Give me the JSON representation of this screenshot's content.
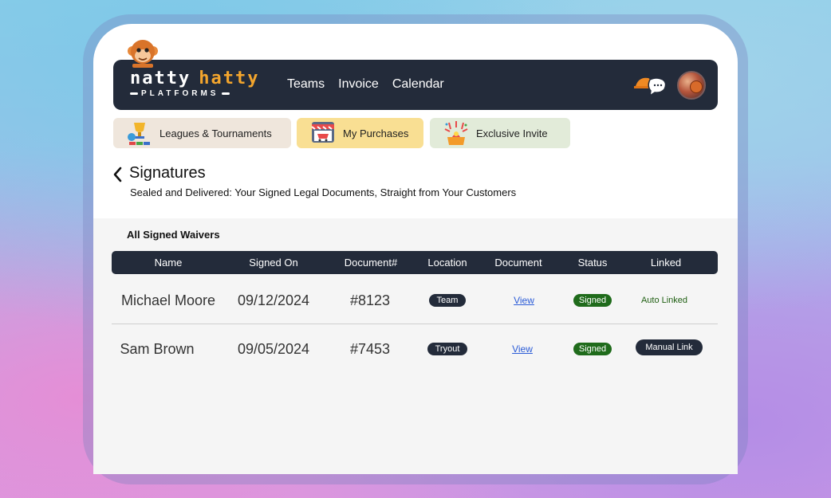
{
  "brand": {
    "word1": "natty",
    "word2": "hatty",
    "sub": "PLATFORMS",
    "accent": "#f3a52d",
    "nav_bg": "#232b3a"
  },
  "nav": {
    "links": [
      "Teams",
      "Invoice",
      "Calendar"
    ]
  },
  "icons": {
    "mascot": "monkey-icon",
    "chat": "cap-chat-icon",
    "avatar": "basketball-avatar",
    "back": "chevron-left-icon"
  },
  "chips": [
    {
      "label": "Leagues & Tournaments",
      "icon": "trophy-icon",
      "color": "#efe6dc"
    },
    {
      "label": "My Purchases",
      "icon": "shop-icon",
      "color": "#f9df93"
    },
    {
      "label": "Exclusive Invite",
      "icon": "party-icon",
      "color": "#e2ebd9"
    }
  ],
  "page": {
    "title": "Signatures",
    "subtitle": "Sealed and Delivered: Your Signed Legal Documents, Straight from Your Customers"
  },
  "section": {
    "title": "All Signed Waivers"
  },
  "table": {
    "columns": [
      "Name",
      "Signed On",
      "Document#",
      "Location",
      "Document",
      "Status",
      "Linked"
    ],
    "rows": [
      {
        "name": "Michael Moore",
        "signed_on": "09/12/2024",
        "doc": "#8123",
        "location": "Team",
        "document": "View ",
        "status": "Signed",
        "linked": "Auto Linked"
      },
      {
        "name": "Sam Brown",
        "signed_on": "09/05/2024",
        "doc": "#7453",
        "location": "Tryout",
        "document": "View ",
        "status": "Signed",
        "linked": "Manual Link"
      }
    ]
  }
}
